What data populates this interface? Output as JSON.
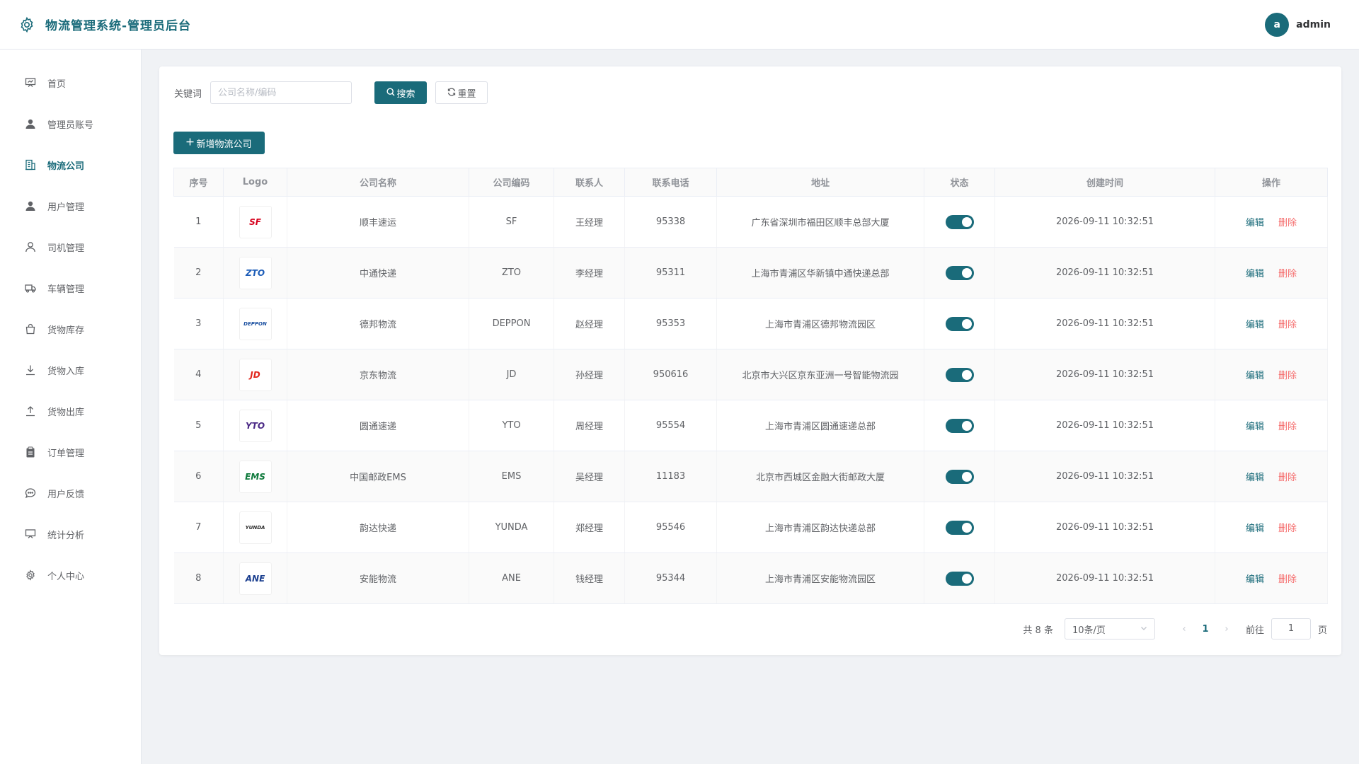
{
  "header": {
    "title": "物流管理系统-管理员后台",
    "avatar_letter": "a",
    "username": "admin",
    "brand_icon": "gear-icon"
  },
  "sidebar": {
    "items": [
      {
        "label": "首页",
        "icon": "presentation-icon"
      },
      {
        "label": "管理员账号",
        "icon": "user-solid-icon"
      },
      {
        "label": "物流公司",
        "icon": "building-icon",
        "active": true
      },
      {
        "label": "用户管理",
        "icon": "user-solid-icon"
      },
      {
        "label": "司机管理",
        "icon": "user-outline-icon"
      },
      {
        "label": "车辆管理",
        "icon": "truck-icon"
      },
      {
        "label": "货物库存",
        "icon": "bag-icon"
      },
      {
        "label": "货物入库",
        "icon": "download-icon"
      },
      {
        "label": "货物出库",
        "icon": "upload-icon"
      },
      {
        "label": "订单管理",
        "icon": "clipboard-icon"
      },
      {
        "label": "用户反馈",
        "icon": "chat-icon"
      },
      {
        "label": "统计分析",
        "icon": "presentation-icon"
      },
      {
        "label": "个人中心",
        "icon": "gear-icon"
      }
    ]
  },
  "search": {
    "label": "关键词",
    "placeholder": "公司名称/编码",
    "value": "",
    "search_label": "搜索",
    "reset_label": "重置"
  },
  "add_label": "新增物流公司",
  "table": {
    "headers": [
      "序号",
      "Logo",
      "公司名称",
      "公司编码",
      "联系人",
      "联系电话",
      "地址",
      "状态",
      "创建时间",
      "操作"
    ],
    "edit_label": "编辑",
    "delete_label": "删除",
    "rows": [
      {
        "index": "1",
        "logo": "SF",
        "logo_color": "#d6001c",
        "name": "顺丰速运",
        "code": "SF",
        "contact": "王经理",
        "phone": "95338",
        "address": "广东省深圳市福田区顺丰总部大厦",
        "status": true,
        "created": "2026-09-11 10:32:51"
      },
      {
        "index": "2",
        "logo": "ZTO",
        "logo_color": "#1d5db8",
        "name": "中通快递",
        "code": "ZTO",
        "contact": "李经理",
        "phone": "95311",
        "address": "上海市青浦区华新镇中通快递总部",
        "status": true,
        "created": "2026-09-11 10:32:51"
      },
      {
        "index": "3",
        "logo": "DEPPON",
        "logo_color": "#1a4fa0",
        "name": "德邦物流",
        "code": "DEPPON",
        "contact": "赵经理",
        "phone": "95353",
        "address": "上海市青浦区德邦物流园区",
        "status": true,
        "created": "2026-09-11 10:32:51"
      },
      {
        "index": "4",
        "logo": "JD",
        "logo_color": "#e1251b",
        "name": "京东物流",
        "code": "JD",
        "contact": "孙经理",
        "phone": "950616",
        "address": "北京市大兴区京东亚洲一号智能物流园",
        "status": true,
        "created": "2026-09-11 10:32:51"
      },
      {
        "index": "5",
        "logo": "YTO",
        "logo_color": "#4b2a86",
        "name": "圆通速递",
        "code": "YTO",
        "contact": "周经理",
        "phone": "95554",
        "address": "上海市青浦区圆通速递总部",
        "status": true,
        "created": "2026-09-11 10:32:51"
      },
      {
        "index": "6",
        "logo": "EMS",
        "logo_color": "#0f7a3c",
        "name": "中国邮政EMS",
        "code": "EMS",
        "contact": "吴经理",
        "phone": "11183",
        "address": "北京市西城区金融大街邮政大厦",
        "status": true,
        "created": "2026-09-11 10:32:51"
      },
      {
        "index": "7",
        "logo": "YUNDA",
        "logo_color": "#2a2a2a",
        "name": "韵达快递",
        "code": "YUNDA",
        "contact": "郑经理",
        "phone": "95546",
        "address": "上海市青浦区韵达快递总部",
        "status": true,
        "created": "2026-09-11 10:32:51"
      },
      {
        "index": "8",
        "logo": "ANE",
        "logo_color": "#1b3f8f",
        "name": "安能物流",
        "code": "ANE",
        "contact": "钱经理",
        "phone": "95344",
        "address": "上海市青浦区安能物流园区",
        "status": true,
        "created": "2026-09-11 10:32:51"
      }
    ]
  },
  "pagination": {
    "total_text": "共 8 条",
    "page_size": "10条/页",
    "prev": "‹",
    "current": "1",
    "next": "›",
    "goto_label": "前往",
    "goto_value": "1",
    "unit_label": "页"
  },
  "colors": {
    "primary": "#1a6b7a",
    "danger": "#f56c6c"
  }
}
